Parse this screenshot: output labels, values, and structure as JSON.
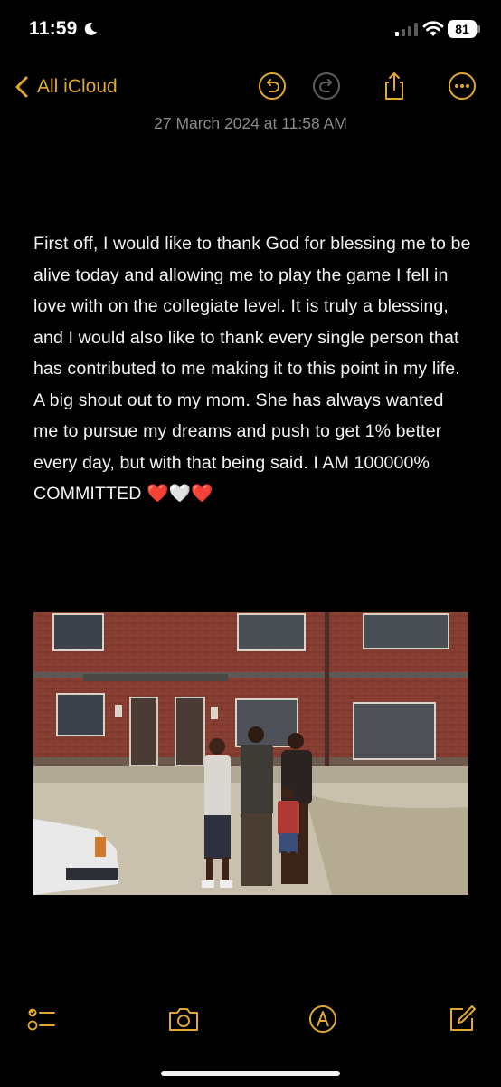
{
  "status_bar": {
    "time": "11:59",
    "battery": "81",
    "icons": [
      "moon-icon",
      "signal-icon",
      "wifi-icon",
      "battery-icon"
    ]
  },
  "nav": {
    "back_label": "All iCloud",
    "actions": [
      "undo-icon",
      "redo-icon",
      "share-icon",
      "more-icon"
    ]
  },
  "note": {
    "date": "27 March 2024 at 11:58 AM",
    "body": "First off, I would like to thank God for blessing me to be alive today and allowing me to play the game I fell in love with on the collegiate level. It is truly a blessing, and I would also like to thank every single person that has contributed to me making it to this point in my life. A big shout out to my mom. She has always wanted me to pursue my dreams and push to get 1% better every day, but with that being said. I AM 100000% COMMITTED ❤️🤍❤️"
  },
  "toolbar": {
    "items": [
      "checklist-icon",
      "camera-icon",
      "markup-icon",
      "compose-icon"
    ]
  },
  "colors": {
    "accent": "#e0a82e",
    "background": "#000000",
    "text": "#f2f2f2",
    "secondary_text": "#8a8a8e"
  }
}
